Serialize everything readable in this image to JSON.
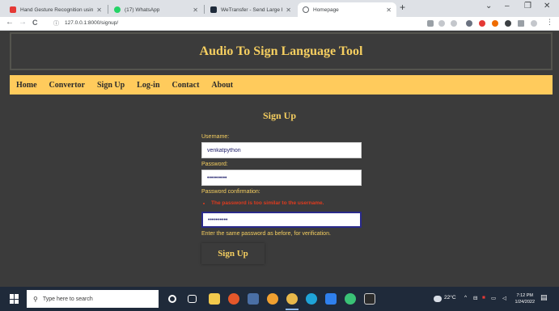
{
  "browser": {
    "tabs": [
      {
        "title": "Hand Gesture Recognition using",
        "favicon_color": "#e53935",
        "active": false
      },
      {
        "title": "(17) WhatsApp",
        "favicon_color": "#25d366",
        "active": false
      },
      {
        "title": "WeTransfer - Send Large Files &",
        "favicon_color": "#1e2a3a",
        "active": false
      },
      {
        "title": "Homepage",
        "favicon_color": "#5f6368",
        "active": true
      }
    ],
    "new_tab": "+",
    "window_controls": {
      "chevron": "⌄",
      "minimize": "–",
      "maximize": "❐",
      "close": "✕"
    },
    "nav": {
      "back": "←",
      "forward": "→",
      "reload": "C"
    },
    "url": "127.0.0.1:8000/signup/",
    "url_icon": "info-icon"
  },
  "site": {
    "title": "Audio To Sign Language Tool",
    "nav": [
      "Home",
      "Convertor",
      "Sign Up",
      "Log-in",
      "Contact",
      "About"
    ],
    "colors": {
      "accent": "#f6cf60",
      "navbar": "#ffcb5c",
      "background": "#3b3b3b",
      "error": "#e03b1e"
    }
  },
  "form": {
    "heading": "Sign Up",
    "username_label": "Username:",
    "username_value": "venkatpython",
    "password_label": "Password:",
    "password_value": "••••••••••",
    "confirm_label": "Password confirmation:",
    "error": "The password is too similar to the username.",
    "confirm_value": "••••••••••",
    "help_text": "Enter the same password as before, for verification.",
    "submit_label": "Sign Up"
  },
  "taskbar": {
    "search_placeholder": "Type here to search",
    "weather": "22°C",
    "time": "7:12 PM",
    "date": "1/24/2022"
  }
}
